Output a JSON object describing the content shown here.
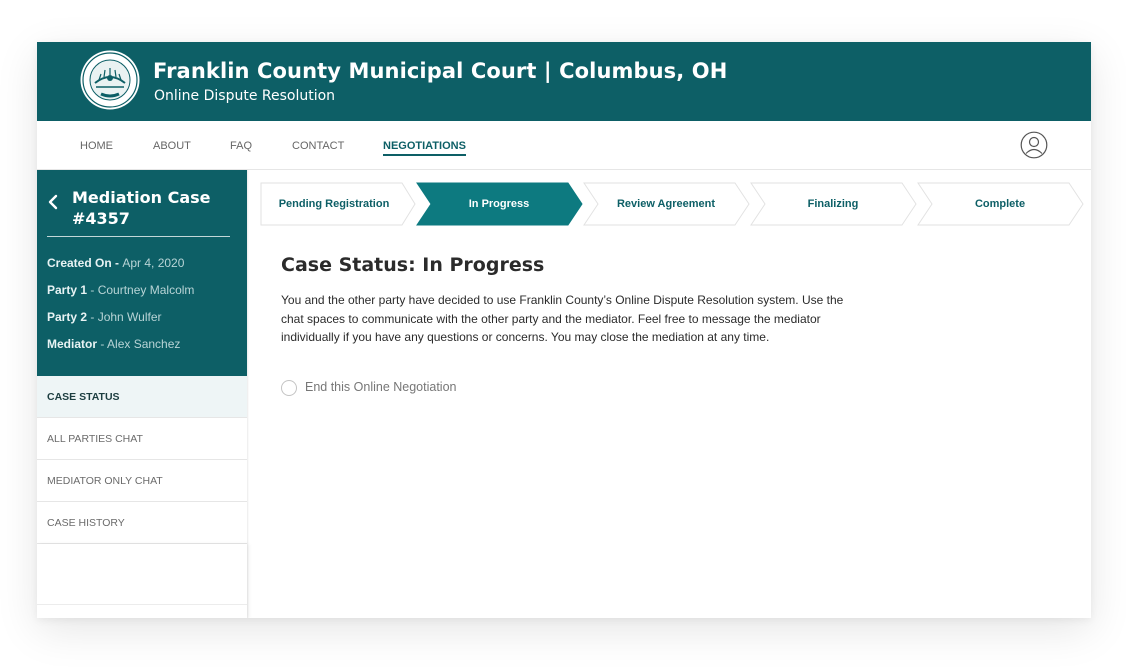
{
  "header": {
    "title": "Franklin County Municipal Court | Columbus, OH",
    "subtitle": "Online Dispute Resolution",
    "seal_icon": "county-seal-icon",
    "background_color": "#0d5f66"
  },
  "nav": {
    "items": [
      {
        "label": "HOME",
        "active": false
      },
      {
        "label": "ABOUT",
        "active": false
      },
      {
        "label": "FAQ",
        "active": false
      },
      {
        "label": "CONTACT",
        "active": false
      },
      {
        "label": "NEGOTIATIONS",
        "active": true
      }
    ],
    "user_icon": "user-avatar-icon"
  },
  "case": {
    "title": "Mediation Case #4357",
    "back_icon": "chevron-left-icon",
    "details": [
      {
        "key": "Created On",
        "value": "Apr 4, 2020"
      },
      {
        "key": "Party 1",
        "value": "Courtney Malcolm"
      },
      {
        "key": "Party 2",
        "value": "John Wulfer"
      },
      {
        "key": "Mediator",
        "value": "Alex Sanchez"
      }
    ]
  },
  "sidebar": {
    "items": [
      {
        "label": "CASE STATUS",
        "active": true
      },
      {
        "label": "ALL PARTIES CHAT",
        "active": false
      },
      {
        "label": "MEDIATOR ONLY CHAT",
        "active": false
      },
      {
        "label": "CASE HISTORY",
        "active": false
      }
    ]
  },
  "stepper": {
    "steps": [
      {
        "label": "Pending Registration",
        "active": false
      },
      {
        "label": "In Progress",
        "active": true
      },
      {
        "label": "Review Agreement",
        "active": false
      },
      {
        "label": "Finalizing",
        "active": false
      },
      {
        "label": "Complete",
        "active": false
      }
    ],
    "active_color": "#0d7a80"
  },
  "status": {
    "title": "Case Status: In Progress",
    "body": "You and the other party have decided to use Franklin County’s Online Dispute Resolution system. Use the chat spaces to communicate with the other party and the mediator. Feel free to message the mediator individually if you have any questions or concerns. You may close the mediation at any time.",
    "end_option": "End this Online Negotiation"
  }
}
